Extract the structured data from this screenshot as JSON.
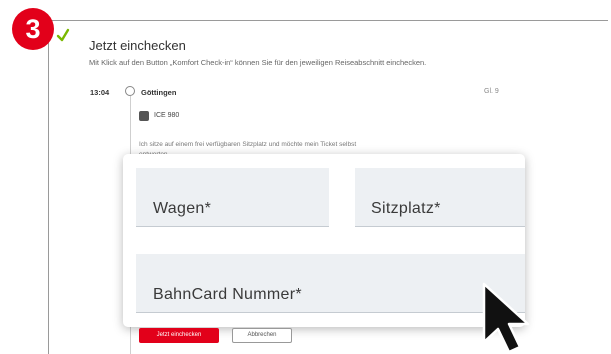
{
  "step": {
    "number": "3"
  },
  "header": {
    "title": "Jetzt einchecken",
    "subtitle": "Mit Klick auf den Button „Komfort Check-in“ können Sie für den jeweiligen Reiseabschnitt einchecken."
  },
  "journey": {
    "time": "13:04",
    "station": "Göttingen",
    "platform": "Gl. 9",
    "train": "ICE 980",
    "info": "Ich sitze auf einem frei verfügbaren Sitzplatz und möchte mein Ticket selbst entwerten."
  },
  "form": {
    "wagen_label": "Wagen*",
    "sitzplatz_label": "Sitzplatz*",
    "bahncard_label": "BahnCard Nummer*"
  },
  "actions": {
    "checkin_label": "Jetzt einchecken",
    "cancel_label": "Abbrechen"
  },
  "icons": {
    "step": "step-number-badge",
    "check": "check-icon",
    "station": "station-marker-icon",
    "train": "train-icon",
    "cursor": "mouse-pointer-icon"
  },
  "colors": {
    "brand": "#e2001a",
    "field_bg": "#edf0f3",
    "check": "#7ab800"
  }
}
